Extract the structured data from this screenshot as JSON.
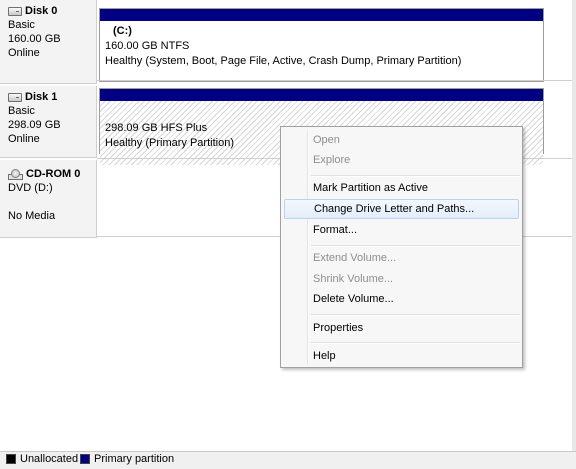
{
  "disks": [
    {
      "name": "Disk 0",
      "type": "Basic",
      "size": "160.00 GB",
      "status": "Online",
      "volume": {
        "letter": "(C:)",
        "desc": "160.00 GB NTFS",
        "health": "Healthy (System, Boot, Page File, Active, Crash Dump, Primary Partition)"
      }
    },
    {
      "name": "Disk 1",
      "type": "Basic",
      "size": "298.09 GB",
      "status": "Online",
      "volume": {
        "desc": "298.09 GB HFS Plus",
        "health": "Healthy (Primary Partition)"
      }
    },
    {
      "name": "CD-ROM 0",
      "type": "DVD (D:)",
      "status": "No Media"
    }
  ],
  "context_menu": {
    "items": [
      {
        "label": "Open",
        "enabled": false
      },
      {
        "label": "Explore",
        "enabled": false
      },
      {
        "label": "Mark Partition as Active",
        "enabled": true
      },
      {
        "label": "Change Drive Letter and Paths...",
        "enabled": true,
        "highlighted": true
      },
      {
        "label": "Format...",
        "enabled": true
      },
      {
        "label": "Extend Volume...",
        "enabled": false
      },
      {
        "label": "Shrink Volume...",
        "enabled": false
      },
      {
        "label": "Delete Volume...",
        "enabled": true
      },
      {
        "label": "Properties",
        "enabled": true
      },
      {
        "label": "Help",
        "enabled": true
      }
    ]
  },
  "legend": [
    {
      "label": "Unallocated",
      "color": "#000000"
    },
    {
      "label": "Primary partition",
      "color": "#000080"
    }
  ],
  "colors": {
    "primary_bar": "#000080",
    "unallocated": "#000000"
  }
}
